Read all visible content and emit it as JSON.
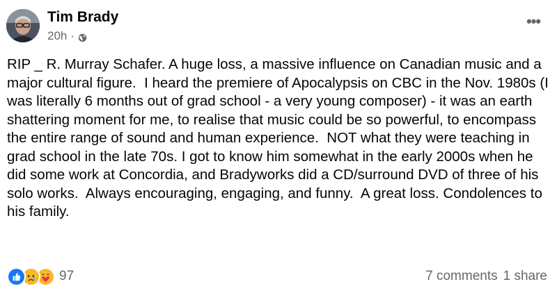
{
  "post": {
    "author": "Tim Brady",
    "time": "20h",
    "separator": "·",
    "privacy_icon": "globe-icon",
    "more_icon": "more-options-icon",
    "more_label": "•••",
    "text": "RIP _ R. Murray Schafer. A huge loss, a massive influence on Canadian music and a major cultural figure.  I heard the premiere of Apocalypsis on CBC in the Nov. 1980s (I was literally 6 months out of grad school - a very young composer) - it was an earth shattering moment for me, to realise that music could be so powerful, to encompass the entire range of sound and human experience.  NOT what they were teaching in grad school in the late 70s. I got to know him somewhat in the early 2000s when he did some work at Concordia, and Bradyworks did a CD/surround DVD of three of his solo works.  Always encouraging, engaging, and funny.  A great loss. Condolences to his family."
  },
  "footer": {
    "reaction_icons": [
      "like-icon",
      "sad-icon",
      "care-icon"
    ],
    "reaction_count": "97",
    "comments": "7 comments",
    "shares": "1 share"
  },
  "colors": {
    "text": "#050505",
    "secondary": "#65676b",
    "like_blue": "#1877f2",
    "emoji_yellow": "#f7b928"
  }
}
